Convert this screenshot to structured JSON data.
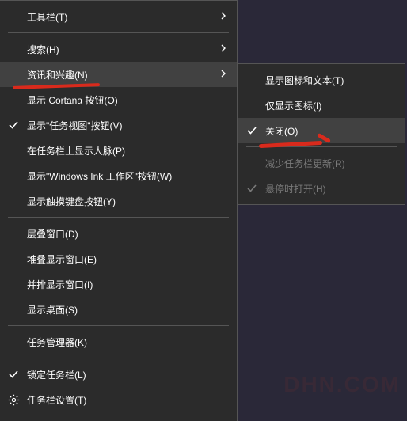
{
  "main_menu": {
    "items": [
      {
        "label": "工具栏(T)",
        "submenu": true
      },
      {
        "sep": true
      },
      {
        "label": "搜索(H)",
        "submenu": true
      },
      {
        "label": "资讯和兴趣(N)",
        "submenu": true,
        "hover": true,
        "red_underline": true
      },
      {
        "label": "显示 Cortana 按钮(O)"
      },
      {
        "label": "显示\"任务视图\"按钮(V)",
        "checked": true
      },
      {
        "label": "在任务栏上显示人脉(P)"
      },
      {
        "label": "显示\"Windows Ink 工作区\"按钮(W)"
      },
      {
        "label": "显示触摸键盘按钮(Y)"
      },
      {
        "sep": true
      },
      {
        "label": "层叠窗口(D)"
      },
      {
        "label": "堆叠显示窗口(E)"
      },
      {
        "label": "并排显示窗口(I)"
      },
      {
        "label": "显示桌面(S)"
      },
      {
        "sep": true
      },
      {
        "label": "任务管理器(K)"
      },
      {
        "sep": true
      },
      {
        "label": "锁定任务栏(L)",
        "checked": true
      },
      {
        "label": "任务栏设置(T)",
        "icon": "gear"
      }
    ]
  },
  "sub_menu": {
    "items": [
      {
        "label": "显示图标和文本(T)"
      },
      {
        "label": "仅显示图标(I)"
      },
      {
        "label": "关闭(O)",
        "checked": true,
        "hover": true,
        "red_underline": true
      },
      {
        "sep": true
      },
      {
        "label": "减少任务栏更新(R)",
        "disabled": true
      },
      {
        "label": "悬停时打开(H)",
        "checked": true,
        "disabled": true
      }
    ]
  },
  "watermark": "DHN.COM"
}
